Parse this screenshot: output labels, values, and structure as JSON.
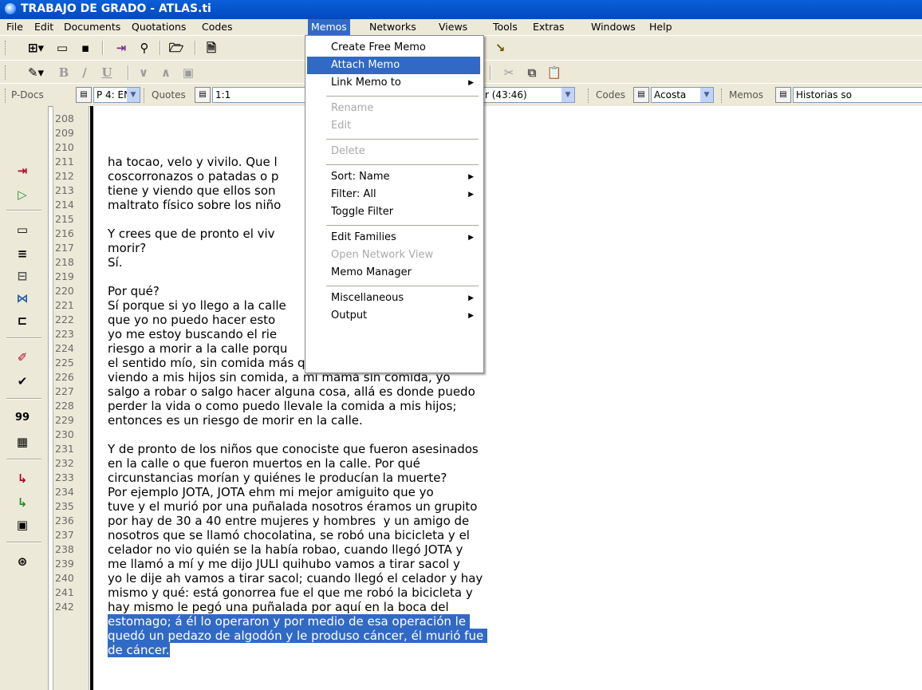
{
  "window": {
    "title": "TRABAJO DE GRADO - ATLAS.ti"
  },
  "menubar": {
    "items": [
      "File",
      "Edit",
      "Documents",
      "Quotations",
      "Codes",
      "Memos",
      "Networks",
      "Views",
      "Tools",
      "Extras",
      "Windows",
      "Help"
    ],
    "active": "Memos"
  },
  "toolbar3": {
    "pdocs_label": "P-Docs",
    "pdocs_value": "P 4: EN",
    "quotes_label": "Quotes",
    "quotes_value": "1:1",
    "quote_tail_value": "r (43:46)",
    "codes_label": "Codes",
    "codes_value": "Acosta",
    "memos_label": "Memos",
    "memos_value": "Historias so"
  },
  "memos_menu": {
    "create_free_memo": "Create Free Memo",
    "attach_memo": "Attach Memo",
    "link_memo_to": "Link Memo to",
    "rename": "Rename",
    "edit": "Edit",
    "delete": "Delete",
    "sort": "Sort: Name",
    "filter": "Filter: All",
    "toggle_filter": "Toggle Filter",
    "edit_families": "Edit Families",
    "open_network_view": "Open Network View",
    "memo_manager": "Memo Manager",
    "miscellaneous": "Miscellaneous",
    "output": "Output"
  },
  "document": {
    "lines": [
      {
        "n": "208",
        "t": "ha tocao, velo y vivilo. Que l"
      },
      {
        "n": "209",
        "t": "coscorronazos o patadas o p                          o que uno"
      },
      {
        "n": "210",
        "t": "tiene y viendo que ellos son                          ntoes sea"
      },
      {
        "n": "211",
        "t": "maltrato físico sobre los niño"
      },
      {
        "n": "212",
        "t": ""
      },
      {
        "n": "213",
        "t": "Y crees que de pronto el viv                          para"
      },
      {
        "n": "214",
        "t": "morir?"
      },
      {
        "n": "215",
        "t": "Sí."
      },
      {
        "n": "216",
        "t": ""
      },
      {
        "n": "217",
        "t": "Por qué?"
      },
      {
        "n": "218",
        "t": "Sí porque si yo llego a la calle                          yo sé"
      },
      {
        "n": "219",
        "t": "que yo no puedo hacer esto                          yo sé que"
      },
      {
        "n": "220",
        "t": "yo me estoy buscando el rie                          orque es"
      },
      {
        "n": "221",
        "t": "riesgo a morir a la calle porqu                          plo en"
      },
      {
        "n": "222",
        "t": "el sentido mío, sin comida más que todo, siendo un hombre y"
      },
      {
        "n": "223",
        "t": "viendo a mis hijos sin comida, a mi mamá sin comida, yo"
      },
      {
        "n": "224",
        "t": "salgo a robar o salgo hacer alguna cosa, allá es donde puedo"
      },
      {
        "n": "225",
        "t": "perder la vida o como puedo llevale la comida a mis hijos;"
      },
      {
        "n": "226",
        "t": "entonces es un riesgo de morir en la calle."
      },
      {
        "n": "227",
        "t": ""
      },
      {
        "n": "228",
        "t": "Y de pronto de los niños que conociste que fueron asesinados"
      },
      {
        "n": "229",
        "t": "en la calle o que fueron muertos en la calle. Por qué"
      },
      {
        "n": "230",
        "t": "circunstancias morían y quiénes le producían la muerte?"
      },
      {
        "n": "231",
        "t": "Por ejemplo JOTA, JOTA ehm mi mejor amiguito que yo"
      },
      {
        "n": "232",
        "t": "tuve y el murió por una puñalada nosotros éramos un grupito"
      },
      {
        "n": "233",
        "t": "por hay de 30 a 40 entre mujeres y hombres  y un amigo de"
      },
      {
        "n": "234",
        "t": "nosotros que se llamó chocolatina, se robó una bicicleta y el"
      },
      {
        "n": "235",
        "t": "celador no vio quién se la había robao, cuando llegó JOTA y"
      },
      {
        "n": "236",
        "t": "me llamó a mí y me dijo JULI quihubo vamos a tirar sacol y"
      },
      {
        "n": "237",
        "t": "yo le dije ah vamos a tirar sacol; cuando llegó el celador y hay"
      },
      {
        "n": "238",
        "t": "mismo y qué: está gonorrea fue el que me robó la bicicleta y"
      },
      {
        "n": "239",
        "t": "hay mismo le pegó una puñalada por aquí en la boca del"
      },
      {
        "n": "240",
        "t": "estomago; á él lo operaron y por medio de esa operación le "
      },
      {
        "n": "241",
        "t": "quedó un pedazo de algodón y le produso cáncer, él murió fue "
      },
      {
        "n": "242",
        "t": "de cáncer."
      }
    ],
    "highlighted_from": "240"
  }
}
